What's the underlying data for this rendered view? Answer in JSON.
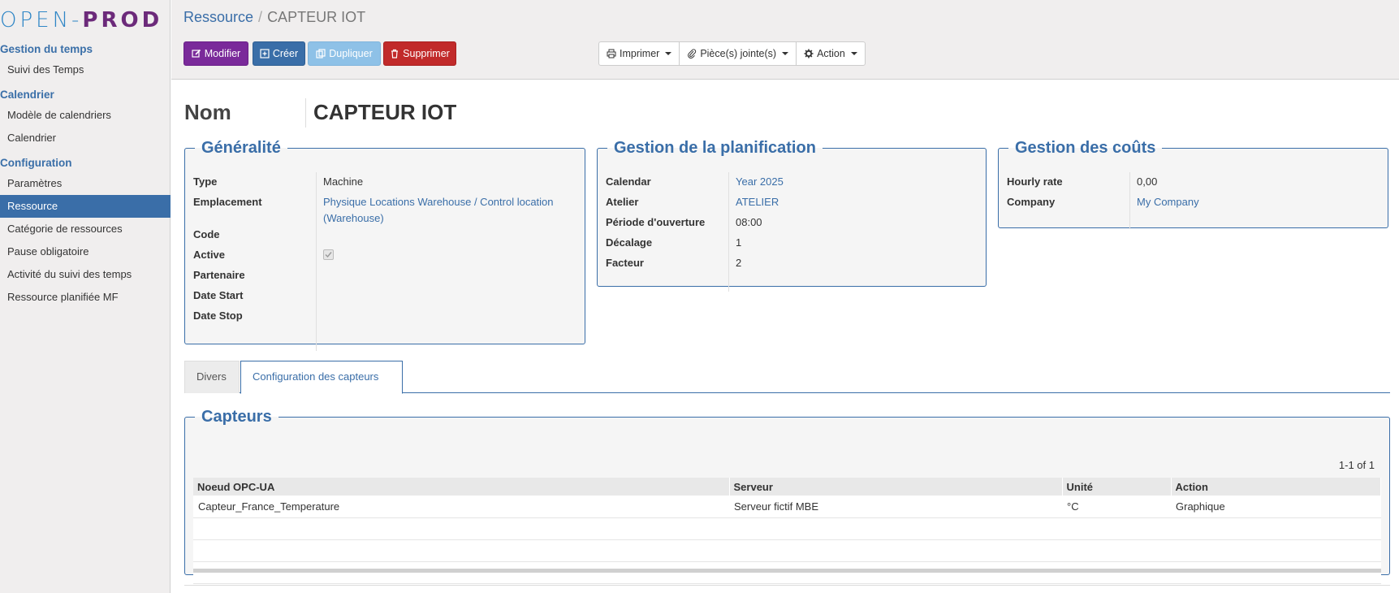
{
  "logo": {
    "part1": "OPEN",
    "dash": "-",
    "part2": "PROD"
  },
  "sidebar": {
    "sections": [
      {
        "title": "Gestion du temps",
        "items": [
          "Suivi des Temps"
        ]
      },
      {
        "title": "Calendrier",
        "items": [
          "Modèle de calendriers",
          "Calendrier"
        ]
      },
      {
        "title": "Configuration",
        "items": [
          "Paramètres",
          "Ressource",
          "Catégorie de ressources",
          "Pause obligatoire",
          "Activité du suivi des temps",
          "Ressource planifiée MF"
        ]
      }
    ],
    "active_item": "Ressource"
  },
  "breadcrumb": {
    "parent": "Ressource",
    "separator": "/",
    "current": "CAPTEUR IOT"
  },
  "toolbar": {
    "modify": "Modifier",
    "create": "Créer",
    "duplicate": "Dupliquer",
    "delete": "Supprimer",
    "print": "Imprimer",
    "attachments": "Pièce(s) jointe(s)",
    "action": "Action"
  },
  "record": {
    "name_label": "Nom",
    "name_value": "CAPTEUR IOT"
  },
  "generalite": {
    "title": "Généralité",
    "type_label": "Type",
    "type_value": "Machine",
    "emplacement_label": "Emplacement",
    "emplacement_value_1": "Physique Locations Warehouse / Control location",
    "emplacement_value_2": "(Warehouse)",
    "code_label": "Code",
    "active_label": "Active",
    "active_checked": true,
    "partenaire_label": "Partenaire",
    "date_start_label": "Date Start",
    "date_stop_label": "Date Stop"
  },
  "planification": {
    "title": "Gestion de la planification",
    "calendar_label": "Calendar",
    "calendar_value": "Year 2025",
    "atelier_label": "Atelier",
    "atelier_value": "ATELIER",
    "periode_label": "Période d'ouverture",
    "periode_value": "08:00",
    "decalage_label": "Décalage",
    "decalage_value": "1",
    "facteur_label": "Facteur",
    "facteur_value": "2"
  },
  "couts": {
    "title": "Gestion des coûts",
    "hourly_label": "Hourly rate",
    "hourly_value": "0,00",
    "company_label": "Company",
    "company_value": "My Company"
  },
  "tabs": {
    "divers": "Divers",
    "config": "Configuration des capteurs"
  },
  "capteurs": {
    "title": "Capteurs",
    "pager": "1-1 of 1",
    "columns": [
      "Noeud OPC-UA",
      "Serveur",
      "Unité",
      "Action"
    ],
    "rows": [
      [
        "Capteur_France_Temperature",
        "Serveur fictif MBE",
        "°C",
        "Graphique"
      ]
    ]
  },
  "colors": {
    "accent": "#3a6ea8",
    "modify": "#7a2a9a",
    "delete": "#c12a2a",
    "duplicate": "#8ec1e7"
  }
}
